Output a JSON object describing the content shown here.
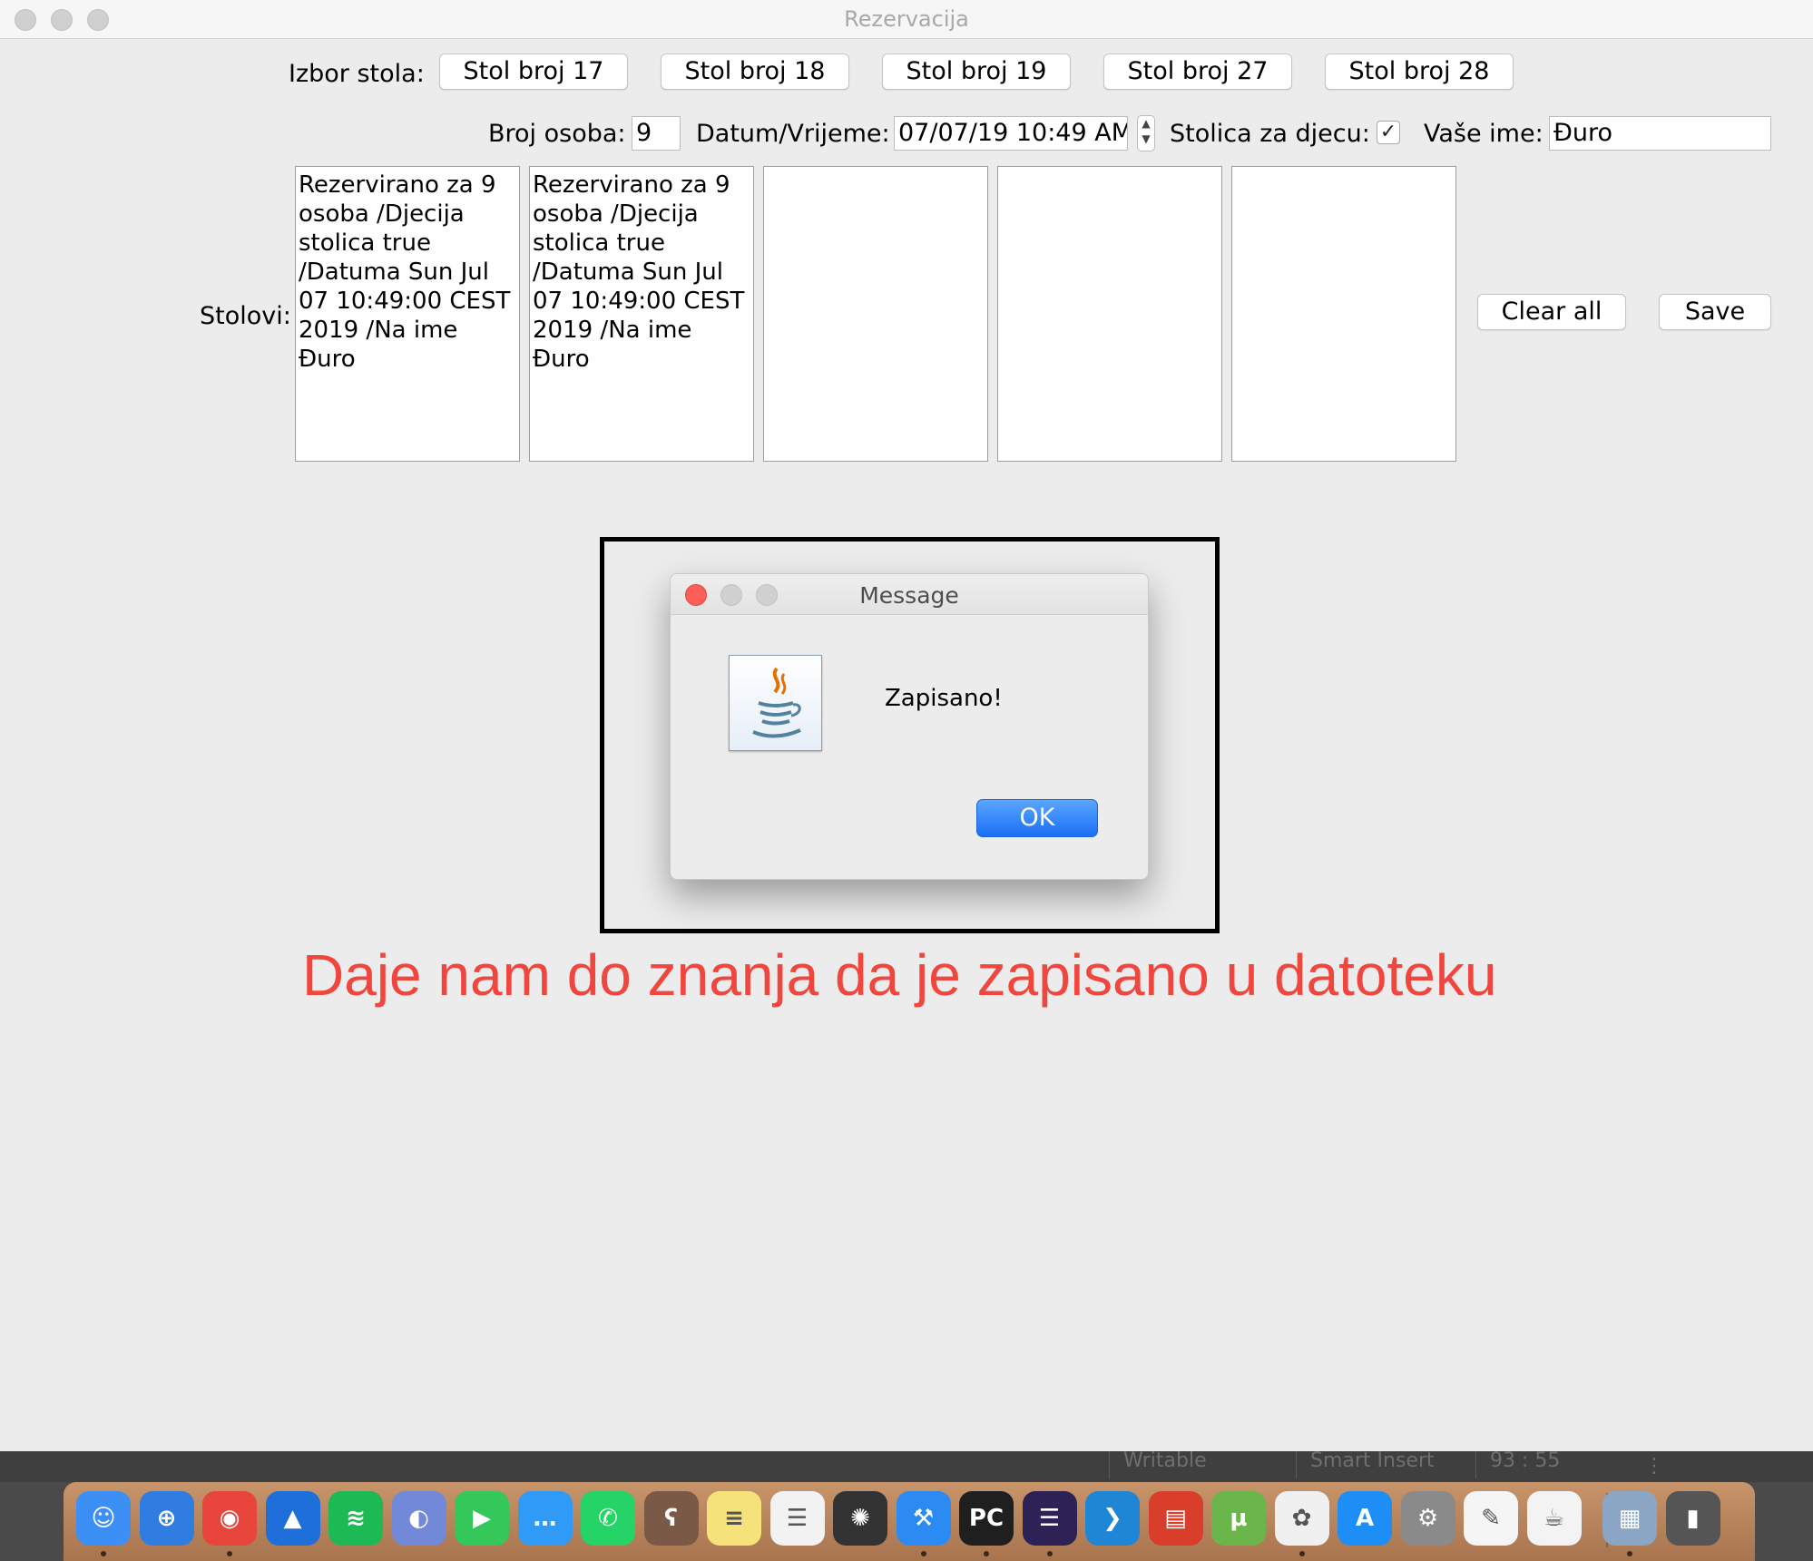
{
  "window": {
    "title": "Rezervacija"
  },
  "table_select": {
    "label": "Izbor stola:",
    "buttons": [
      "Stol broj 17",
      "Stol broj 18",
      "Stol broj 19",
      "Stol broj 27",
      "Stol broj 28"
    ]
  },
  "form": {
    "persons_label": "Broj osoba:",
    "persons_value": "9",
    "datetime_label": "Datum/Vrijeme:",
    "datetime_value": "07/07/19 10:49 AM",
    "child_seat_label": "Stolica za djecu:",
    "child_seat_checked": true,
    "child_seat_mark": "✓",
    "name_label": "Vaše ime:",
    "name_value": "Đuro"
  },
  "tables": {
    "label": "Stolovi:",
    "areas": [
      "Rezervirano za 9\nosoba /Djecija\nstolica true\n/Datuma Sun Jul\n07 10:49:00 CEST\n2019 /Na ime\nĐuro",
      "Rezervirano za 9\nosoba /Djecija\nstolica true\n/Datuma Sun Jul\n07 10:49:00 CEST\n2019 /Na ime\nĐuro",
      "",
      "",
      ""
    ]
  },
  "actions": {
    "clear_label": "Clear all",
    "save_label": "Save"
  },
  "dialog": {
    "title": "Message",
    "message": "Zapisano!",
    "ok_label": "OK",
    "icon": "java-icon"
  },
  "annotation": "Daje nam do znanja da  je zapisano u datoteku",
  "statusbar": {
    "mode": "Writable",
    "insert": "Smart Insert",
    "position": "93 : 55"
  },
  "dock": {
    "apps": [
      {
        "name": "finder-icon",
        "color": "#3b8ff5",
        "glyph": "☺"
      },
      {
        "name": "safari-icon",
        "color": "#2f7de1",
        "glyph": "⊕"
      },
      {
        "name": "chrome-icon",
        "color": "#e8453c",
        "glyph": "◉"
      },
      {
        "name": "navigation-app-icon",
        "color": "#1e6fd9",
        "glyph": "▲"
      },
      {
        "name": "spotify-icon",
        "color": "#1db954",
        "glyph": "≋"
      },
      {
        "name": "discord-icon",
        "color": "#7289da",
        "glyph": "◐"
      },
      {
        "name": "facetime-icon",
        "color": "#34c759",
        "glyph": "▶"
      },
      {
        "name": "messages-icon",
        "color": "#2f9bf7",
        "glyph": "…"
      },
      {
        "name": "whatsapp-icon",
        "color": "#25d366",
        "glyph": "✆"
      },
      {
        "name": "bear-icon",
        "color": "#7a5a46",
        "glyph": "ʕ"
      },
      {
        "name": "notes-icon",
        "color": "#f5e27a",
        "glyph": "≡"
      },
      {
        "name": "reminders-icon",
        "color": "#f2f2f2",
        "glyph": "☰"
      },
      {
        "name": "aperture-icon",
        "color": "#333333",
        "glyph": "✺"
      },
      {
        "name": "xcode-icon",
        "color": "#2b8bf2",
        "glyph": "⚒"
      },
      {
        "name": "pycharm-icon",
        "color": "#1f1f1f",
        "glyph": "PC"
      },
      {
        "name": "eclipse-icon",
        "color": "#2c2255",
        "glyph": "☰"
      },
      {
        "name": "vscode-icon",
        "color": "#1f86d6",
        "glyph": "❯"
      },
      {
        "name": "popcorn-time-icon",
        "color": "#d93e2b",
        "glyph": "▤"
      },
      {
        "name": "utorrent-icon",
        "color": "#6ab64a",
        "glyph": "µ"
      },
      {
        "name": "photos-icon",
        "color": "#f0f0f0",
        "glyph": "✿"
      },
      {
        "name": "app-store-icon",
        "color": "#1c8ef5",
        "glyph": "A"
      },
      {
        "name": "system-preferences-icon",
        "color": "#8a8a8a",
        "glyph": "⚙"
      },
      {
        "name": "textedit-icon",
        "color": "#f5f5f5",
        "glyph": "✎"
      },
      {
        "name": "java-app-icon",
        "color": "#f3f3f3",
        "glyph": "☕"
      },
      {
        "name": "downloads-folder-icon",
        "color": "#8aa6c4",
        "glyph": "▦"
      },
      {
        "name": "trash-icon",
        "color": "#555555",
        "glyph": "▮"
      }
    ]
  }
}
